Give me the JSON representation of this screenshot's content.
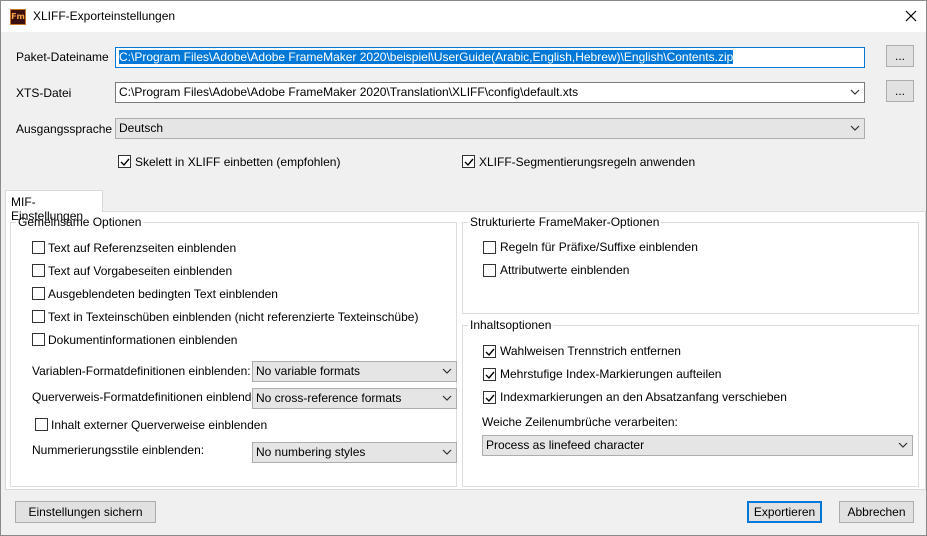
{
  "window": {
    "title": "XLIFF-Exporteinstellungen",
    "icon_text": "Fm"
  },
  "fields": {
    "package_label": "Paket-Dateiname",
    "package_value": "C:\\Program Files\\Adobe\\Adobe FrameMaker 2020\\beispiel\\UserGuide(Arabic,English,Hebrew)\\English\\Contents.zip",
    "xts_label": "XTS-Datei",
    "xts_value": "C:\\Program Files\\Adobe\\Adobe FrameMaker 2020\\Translation\\XLIFF\\config\\default.xts",
    "source_lang_label": "Ausgangssprache",
    "source_lang_value": "Deutsch",
    "browse_label": "..."
  },
  "top_options": {
    "skeleton": {
      "label": "Skelett in XLIFF einbetten (empfohlen)",
      "checked": true
    },
    "segmentation": {
      "label": "XLIFF-Segmentierungsregeln anwenden",
      "checked": true
    }
  },
  "tab": {
    "label": "MIF-Einstellungen"
  },
  "common": {
    "title": "Gemeinsame Optionen",
    "checkboxes": [
      {
        "label": "Text auf Referenzseiten einblenden",
        "checked": false
      },
      {
        "label": "Text auf Vorgabeseiten einblenden",
        "checked": false
      },
      {
        "label": "Ausgeblendeten bedingten Text einblenden",
        "checked": false
      },
      {
        "label": "Text in Texteinschüben einblenden (nicht referenzierte Texteinschübe)",
        "checked": false
      },
      {
        "label": "Dokumentinformationen einblenden",
        "checked": false
      }
    ],
    "variable_label": "Variablen-Formatdefinitionen einblenden:",
    "variable_value": "No variable formats",
    "xref_label": "Querverweis-Formatdefinitionen einblenden:",
    "xref_value": "No cross-reference formats",
    "external_xref": {
      "label": "Inhalt externer Querverweise einblenden",
      "checked": false
    },
    "numbering_label": "Nummerierungsstile einblenden:",
    "numbering_value": "No numbering styles"
  },
  "structured": {
    "title": "Strukturierte FrameMaker-Optionen",
    "checkboxes": [
      {
        "label": "Regeln für Präfixe/Suffixe einblenden",
        "checked": false
      },
      {
        "label": "Attributwerte einblenden",
        "checked": false
      }
    ]
  },
  "content": {
    "title": "Inhaltsoptionen",
    "checkboxes": [
      {
        "label": "Wahlweisen Trennstrich entfernen",
        "checked": true
      },
      {
        "label": "Mehrstufige Index-Markierungen aufteilen",
        "checked": true
      },
      {
        "label": "Indexmarkierungen an den Absatzanfang verschieben",
        "checked": true
      }
    ],
    "softbreak_label": "Weiche Zeilenumbrüche verarbeiten:",
    "softbreak_value": "Process as linefeed character"
  },
  "buttons": {
    "save": "Einstellungen sichern",
    "export": "Exportieren",
    "cancel": "Abbrechen"
  },
  "colors": {
    "accent": "#0078d7",
    "dialog_bg": "#f0f0f0"
  },
  "icons": {
    "close": "close-icon",
    "dropdown": "chevron-down-icon",
    "check": "checkmark-icon"
  }
}
